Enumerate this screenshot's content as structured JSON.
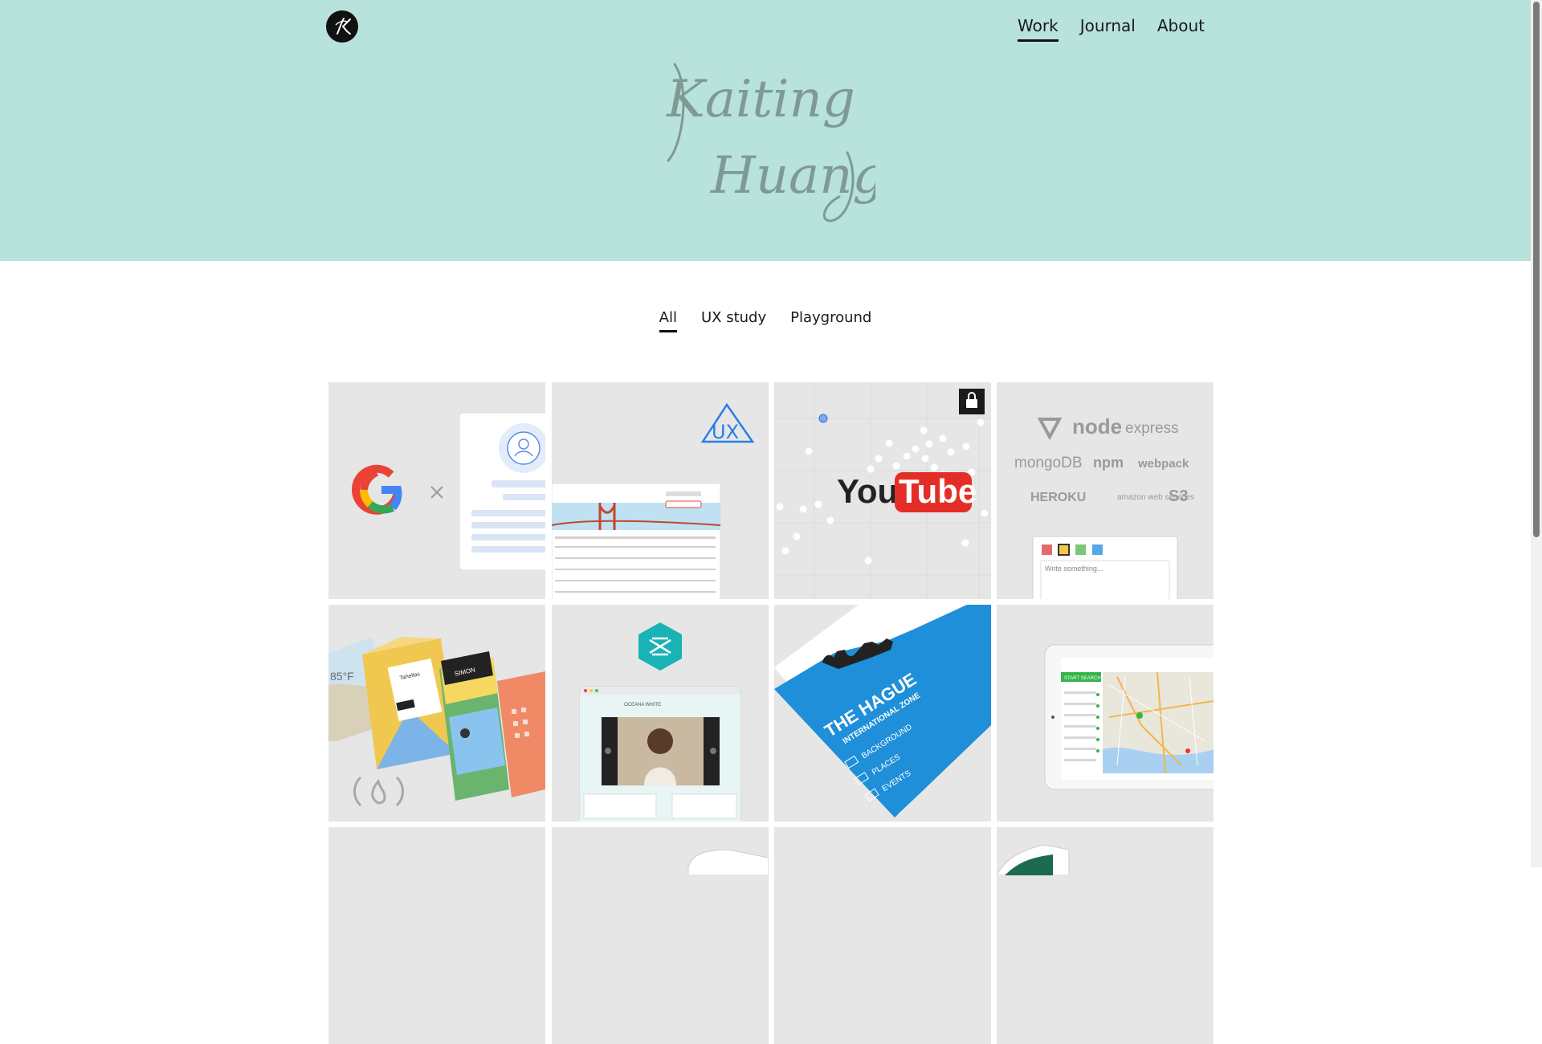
{
  "header": {
    "logo_letter": "K",
    "nav": [
      {
        "label": "Work",
        "active": true
      },
      {
        "label": "Journal",
        "active": false
      },
      {
        "label": "About",
        "active": false
      }
    ],
    "signature_lines": [
      "Kaiting",
      "Huang"
    ]
  },
  "filters": [
    {
      "label": "All",
      "active": true
    },
    {
      "label": "UX study",
      "active": false
    },
    {
      "label": "Playground",
      "active": false
    }
  ],
  "projects": [
    {
      "name": "Google sign-in",
      "locked": false
    },
    {
      "name": "UX table",
      "locked": false
    },
    {
      "name": "YouTube",
      "locked": true
    },
    {
      "name": "Stack",
      "locked": false
    },
    {
      "name": "Weather cards",
      "locked": false
    },
    {
      "name": "Gallery",
      "locked": false
    },
    {
      "name": "The Hague",
      "locked": false
    },
    {
      "name": "Map tablet",
      "locked": false
    }
  ],
  "tile_text": {
    "ux_logo": "UX",
    "youtube_you": "You",
    "youtube_tube": "Tube",
    "stack_labels": [
      "node",
      "express",
      "mongoDB",
      "npm",
      "webpack",
      "HEROKU",
      "amazon web services",
      "S3"
    ],
    "note_placeholder": "Write something...",
    "weather_temp": "85°F",
    "weather_card_name": "Tahellas",
    "weather_card_user": "SIMON",
    "hague_title": "THE HAGUE",
    "hague_subtitle": "INTERNATIONAL ZONE",
    "hague_menu": [
      "BACKGROUND",
      "PLACES",
      "EVENTS"
    ],
    "gallery_caption": "OCEANA WHITE",
    "map_button": "START SEARCH"
  },
  "colors": {
    "hero_bg": "#b8e2dc",
    "tile_bg": "#e6e6e6",
    "youtube_red": "#e52d27",
    "ux_blue": "#2b7de9",
    "hague_blue": "#1e8fd8",
    "gallery_teal": "#1ab3b5"
  }
}
